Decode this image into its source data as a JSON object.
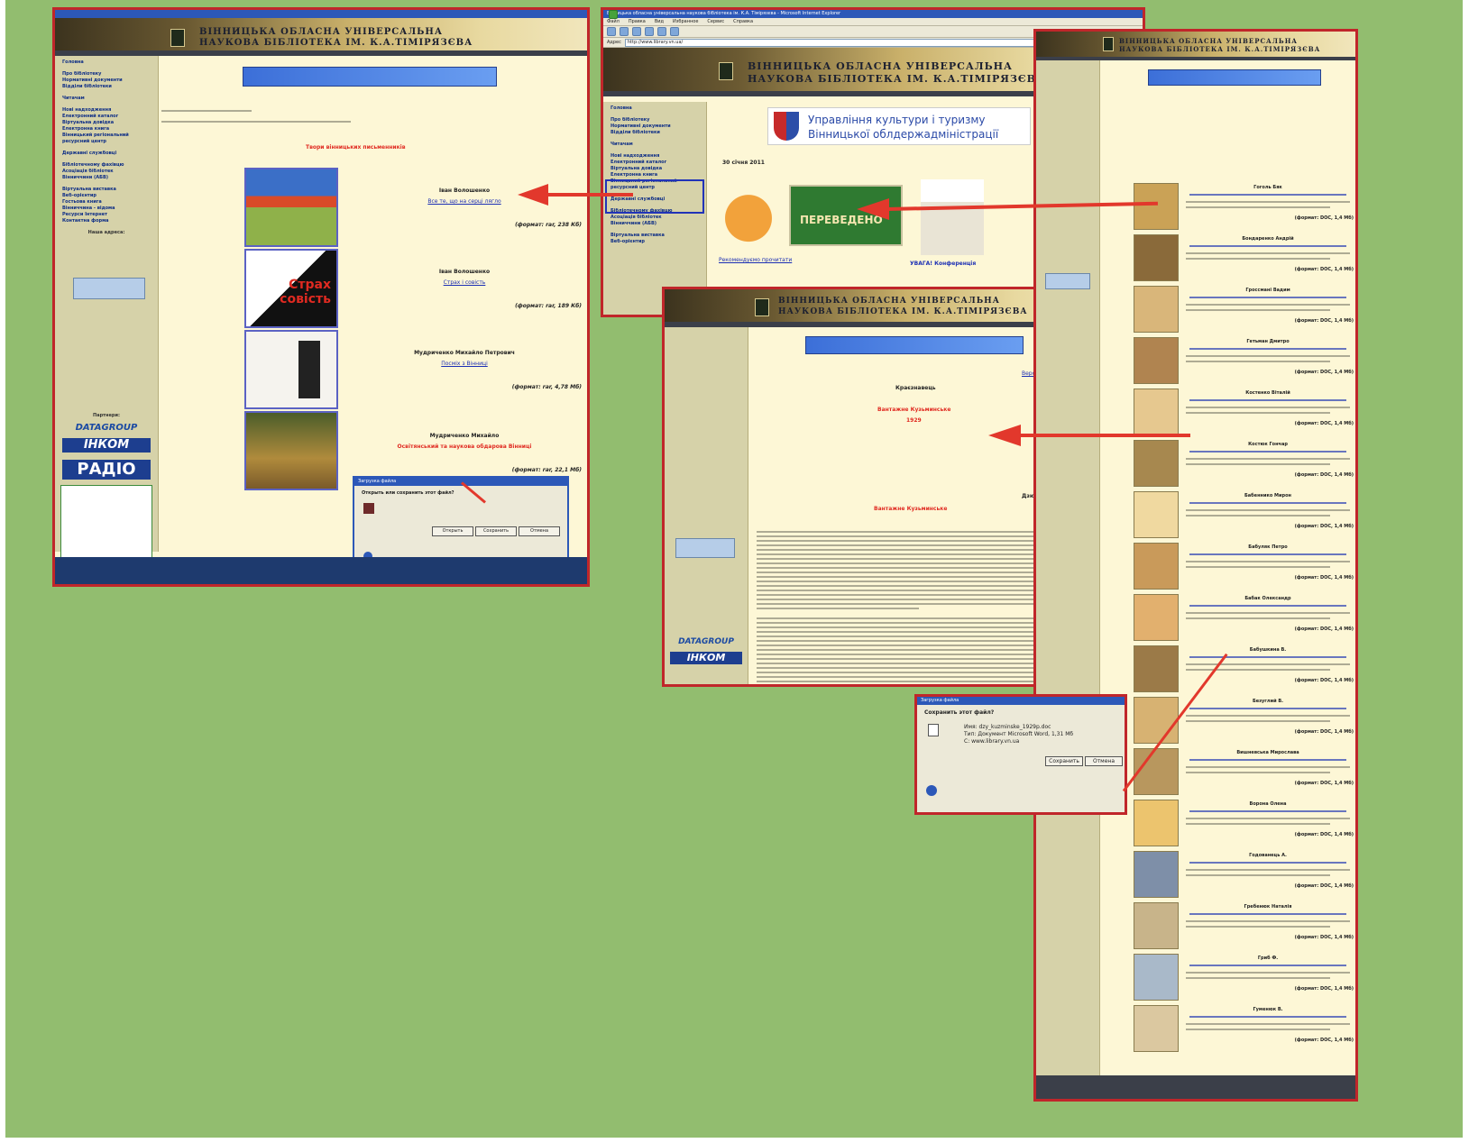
{
  "colors": {
    "background": "#92bd6f",
    "frame": "#c0262a",
    "arrow": "#e2382c",
    "page": "#fdf7d6",
    "sidebar": "#d6d2a9",
    "link": "#1b2eb4",
    "accent_red": "#e02a21"
  },
  "library": {
    "name_line1": "ВІННИЦЬКА ОБЛАСНА УНІВЕРСАЛЬНА",
    "name_line2": "НАУКОВА БІБЛІОТЕКА ІМ. К.А.ТІМІРЯЗЄВА",
    "logo_icon": "book-logo-icon"
  },
  "win1": {
    "sidebar": [
      "Головна",
      "Про бібліотеку",
      "Нормативні документи",
      "Відділи бібліотеки",
      "Читачам",
      "Нові надходження",
      "Електронний каталог",
      "Віртуальна довідка",
      "Електронна книга",
      "Вінницький регіональний",
      "ресурсний центр",
      "Державні службовці",
      "Бібліотечному фахівцю",
      "Асоціація бібліотек",
      "Вінниччини (АБВ)",
      "Віртуальна виставка",
      "Веб-орієнтир",
      "Гостьова книга",
      "Вінниччина - відома",
      "Ресурси Інтернет",
      "Контактна форма"
    ],
    "address_title": "Наша адреса:",
    "partners_title": "Партнери:",
    "partners": [
      "DATAGROUP",
      "ІНКОМ",
      "РАДІО"
    ],
    "heading": "Твори вінницьких письменників",
    "books": [
      {
        "author": "Іван Волошенко",
        "title": "Все те, що на серці лягло",
        "format": "(формат: rar, 238 Кб)"
      },
      {
        "author": "Іван Волошенко",
        "title": "Страх і совість",
        "format": "(формат: rar, 189 Кб)"
      },
      {
        "author": "Мудриченко Михайло Петрович",
        "title": "Посміх з Вінниці",
        "format": "(формат: rar, 4,78 Мб)"
      },
      {
        "author": "Мудриченко Михайло",
        "title": "Освітянський та наукова обдарова Вінниці",
        "format": "(формат: rar, 22,1 Мб)"
      }
    ],
    "cover2_title": "Страх совість",
    "dialog": {
      "title": "Загрузка файла",
      "question": "Открыть или сохранить этот файл?",
      "btn_open": "Открыть",
      "btn_save": "Сохранить",
      "btn_cancel": "Отмена"
    }
  },
  "win2": {
    "title": "Вінницька обласна універсальна наукова бібліотека ім. К.А. Тімірязєва - Microsoft Internet Explorer",
    "menu": [
      "Файл",
      "Правка",
      "Вид",
      "Избранное",
      "Сервис",
      "Справка"
    ],
    "address_label": "Адрес",
    "address": "http://www.library.vn.ua/",
    "culture_banner_line1": "Управління культури і туризму",
    "culture_banner_line2": "Вінницької облдержадміністрації",
    "date": "30 січня 2011",
    "caption_left": "Рекомендуємо прочитати",
    "caption_right": "УВАГА! Конференція",
    "sidebar": [
      "Головна",
      "Про бібліотеку",
      "Нормативні документи",
      "Відділи бібліотеки",
      "Читачам",
      "Нові надходження",
      "Електронний каталог",
      "Віртуальна довідка",
      "Електронна книга",
      "Вінницький регіональний",
      "ресурсний центр",
      "Державні службовці",
      "Бібліотечному фахівцю",
      "Асоціація бібліотек",
      "Вінниччини (АБВ)",
      "Віртуальна виставка",
      "Веб-орієнтир"
    ],
    "free_label": "ПЕРЕВЕДЕНО"
  },
  "win3": {
    "section": "Краєзнавець",
    "author": "Дзюгуракевич Н.",
    "title_red": "Вантажне  Кузьминське",
    "year": "1929",
    "subtitle_red": "Вантажне  Кузьминське",
    "partners": [
      "DATAGROUP",
      "ІНКОМ"
    ],
    "print_link": "Версія для друку"
  },
  "win4": {
    "items": [
      "Гоголь Бяк",
      "Бондаренко Андрій",
      "Гроссмані Вадим",
      "Гетьман Дмитро",
      "Костенко Віталій",
      "Костюк Гончар",
      "Бабеннико Мирон",
      "Бабуляк Петро",
      "Бабак Олександр",
      "Бабушкина В.",
      "Безуглий В.",
      "Вишневська Мирослава",
      "Ворона Олена",
      "Годованець А.",
      "Гребенюк Наталія",
      "Гриб Ф.",
      "Гуменюк В."
    ],
    "format": "(формат: DOC, 1,4 Мб)"
  },
  "win5": {
    "title": "Загрузка файла",
    "question": "Сохранить этот файл?",
    "name": "Имя: dzy_kuzminske_1929p.doc",
    "type": "Тип: Документ Microsoft Word, 1,31 Мб",
    "from": "С: www.library.vn.ua",
    "btn_save": "Сохранить",
    "btn_cancel": "Отмена",
    "warning_icon": "shield-warning-icon"
  }
}
